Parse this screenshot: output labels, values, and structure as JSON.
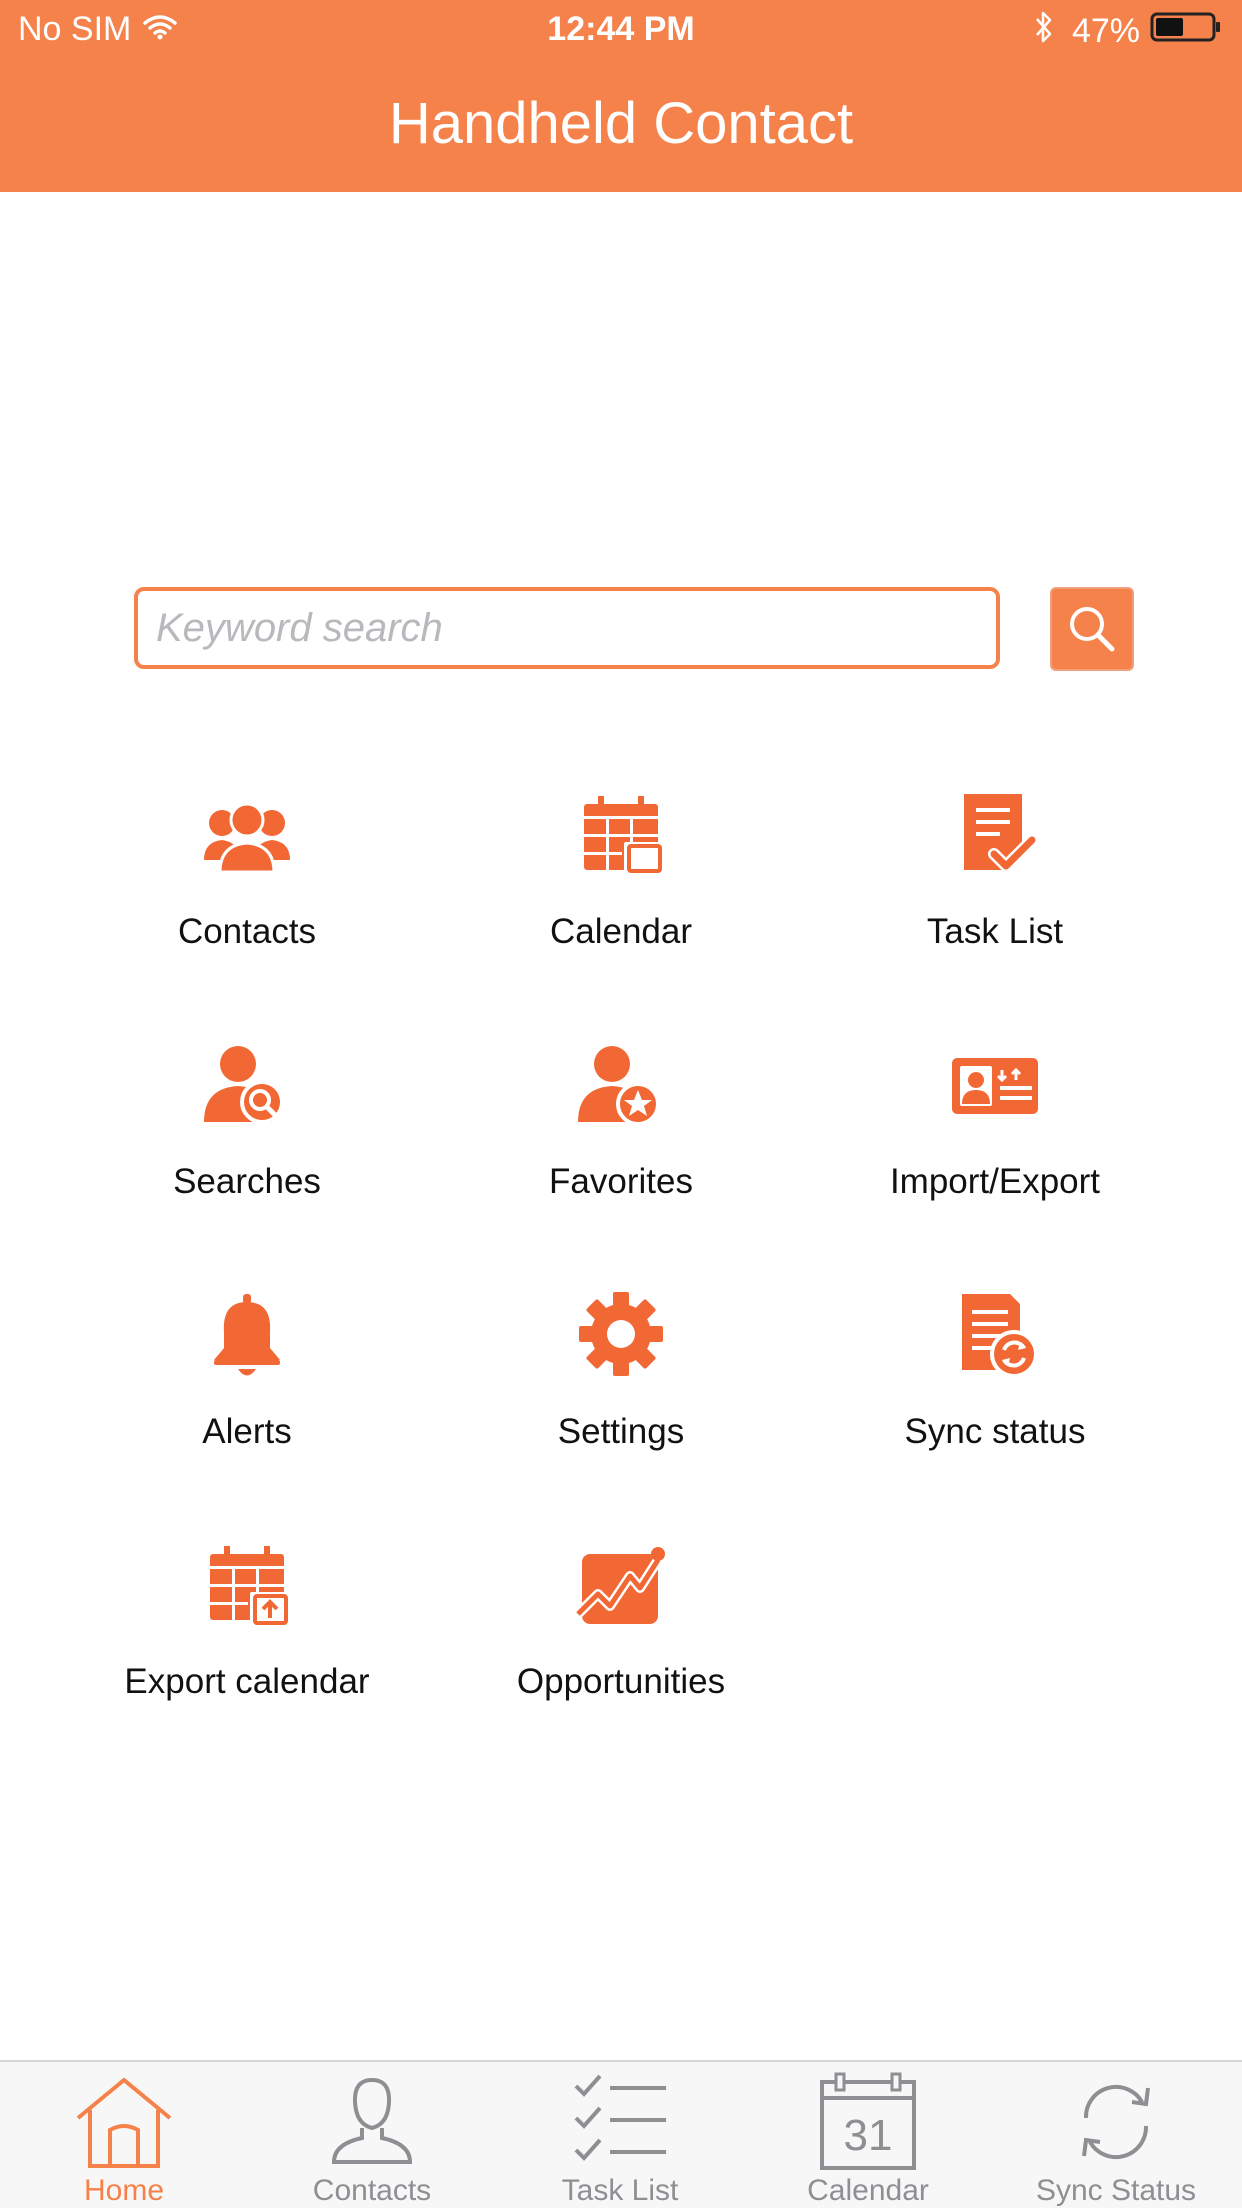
{
  "status_bar": {
    "carrier": "No SIM",
    "time": "12:44 PM",
    "battery": "47%"
  },
  "nav": {
    "title": "Handheld Contact"
  },
  "search": {
    "placeholder": "Keyword search"
  },
  "grid": [
    {
      "label": "Contacts",
      "icon": "contacts-icon"
    },
    {
      "label": "Calendar",
      "icon": "calendar-icon"
    },
    {
      "label": "Task List",
      "icon": "task-list-icon"
    },
    {
      "label": "Searches",
      "icon": "person-search-icon"
    },
    {
      "label": "Favorites",
      "icon": "person-star-icon"
    },
    {
      "label": "Import/Export",
      "icon": "id-card-icon"
    },
    {
      "label": "Alerts",
      "icon": "bell-icon"
    },
    {
      "label": "Settings",
      "icon": "gear-icon"
    },
    {
      "label": "Sync status",
      "icon": "document-sync-icon"
    },
    {
      "label": "Export calendar",
      "icon": "calendar-upload-icon"
    },
    {
      "label": "Opportunities",
      "icon": "trend-chart-icon"
    }
  ],
  "tabs": [
    {
      "label": "Home",
      "icon": "home-icon",
      "active": true
    },
    {
      "label": "Contacts",
      "icon": "person-icon"
    },
    {
      "label": "Task List",
      "icon": "checklist-icon"
    },
    {
      "label": "Calendar",
      "icon": "calendar-icon",
      "day": "31"
    },
    {
      "label": "Sync Status",
      "icon": "sync-icon"
    }
  ],
  "colors": {
    "accent": "#f5824a",
    "icon": "#f26835",
    "tab_inactive": "#8e8e93"
  }
}
